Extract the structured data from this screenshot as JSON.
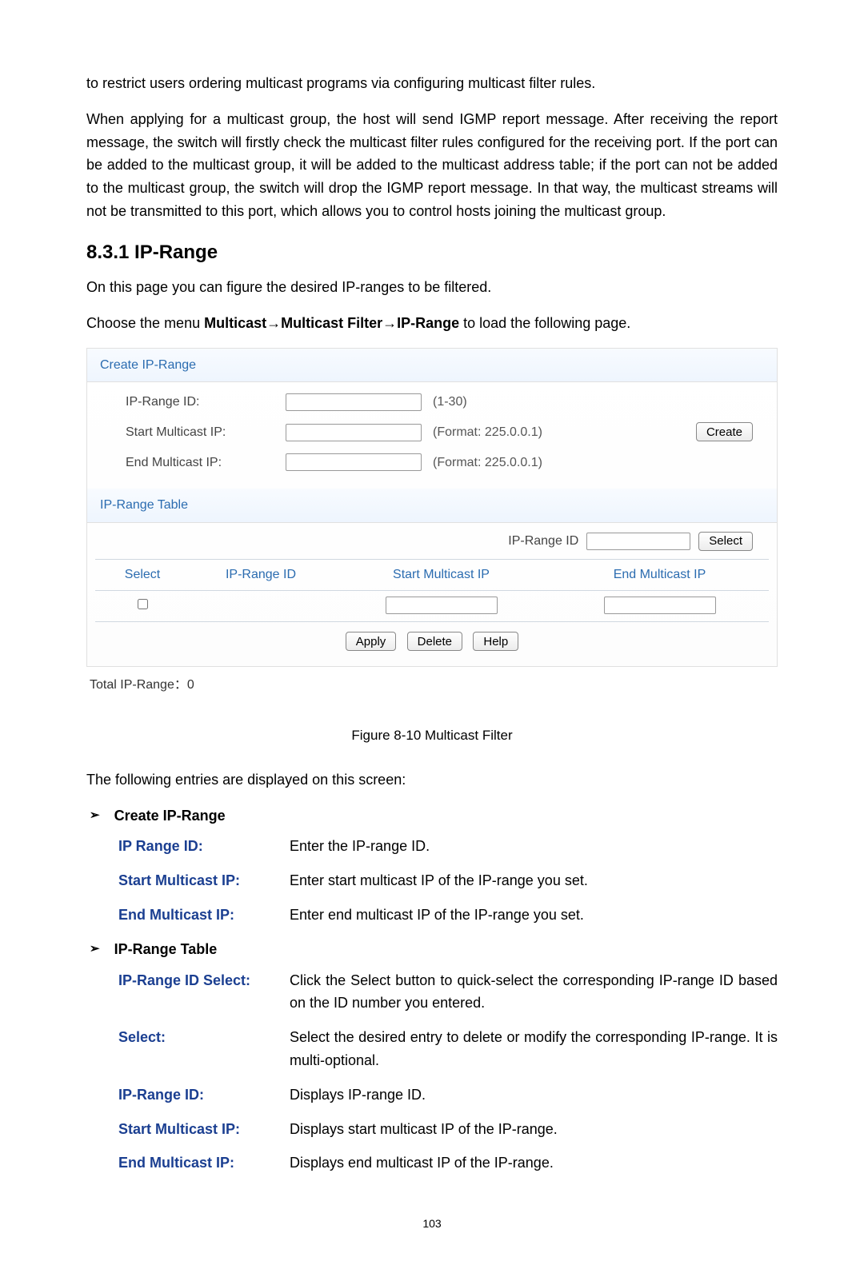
{
  "intro_para_1": "to restrict users ordering multicast programs via configuring multicast filter rules.",
  "intro_para_2": "When applying for a multicast group, the host will send IGMP report message. After receiving the report message, the switch will firstly check the multicast filter rules configured for the receiving port. If the port can be added to the multicast group, it will be added to the multicast address table; if the port can not be added to the multicast group, the switch will drop the IGMP report message. In that way, the multicast streams will not be transmitted to this port, which allows you to control hosts joining the multicast group.",
  "heading_section": "8.3.1 IP-Range",
  "intro_para_3": "On this page you can figure the desired IP-ranges to be filtered.",
  "menu_prefix": "Choose the menu ",
  "menu_path": "Multicast→Multicast Filter→IP-Range",
  "menu_suffix": " to load the following page.",
  "panel": {
    "create_header": "Create IP-Range",
    "labels": {
      "ip_range_id": "IP-Range ID:",
      "start_ip": "Start Multicast IP:",
      "end_ip": "End Multicast IP:"
    },
    "hints": {
      "range": "(1-30)",
      "fmt1": "(Format: 225.0.0.1)",
      "fmt2": "(Format: 225.0.0.1)"
    },
    "create_btn": "Create",
    "table_header": "IP-Range Table",
    "filter_label": "IP-Range ID",
    "select_btn": "Select",
    "cols": {
      "select": "Select",
      "id": "IP-Range ID",
      "start": "Start Multicast IP",
      "end": "End Multicast IP"
    },
    "apply": "Apply",
    "delete": "Delete",
    "help": "Help"
  },
  "total_label": "Total IP-Range：0",
  "figure_caption": "Figure 8-10 Multicast Filter",
  "entries_intro": "The following entries are displayed on this screen:",
  "sections": {
    "create": "Create IP-Range",
    "table": "IP-Range Table"
  },
  "defs_create": [
    {
      "term": "IP Range ID:",
      "desc": "Enter the IP-range ID."
    },
    {
      "term": "Start Multicast IP:",
      "desc": "Enter start multicast IP of the IP-range you set."
    },
    {
      "term": "End Multicast IP:",
      "desc": "Enter end multicast IP of the IP-range you set."
    }
  ],
  "defs_table": [
    {
      "term": "IP-Range ID Select:",
      "desc": "Click the Select button to quick-select the corresponding IP-range ID based on the ID number you entered."
    },
    {
      "term": "Select:",
      "desc": "Select the desired entry to delete or modify the corresponding IP-range. It is multi-optional."
    },
    {
      "term": "IP-Range ID:",
      "desc": "Displays IP-range ID."
    },
    {
      "term": "Start Multicast IP:",
      "desc": "Displays start multicast IP of the IP-range."
    },
    {
      "term": "End Multicast IP:",
      "desc": "Displays end multicast IP of the IP-range."
    }
  ],
  "page_number": "103"
}
